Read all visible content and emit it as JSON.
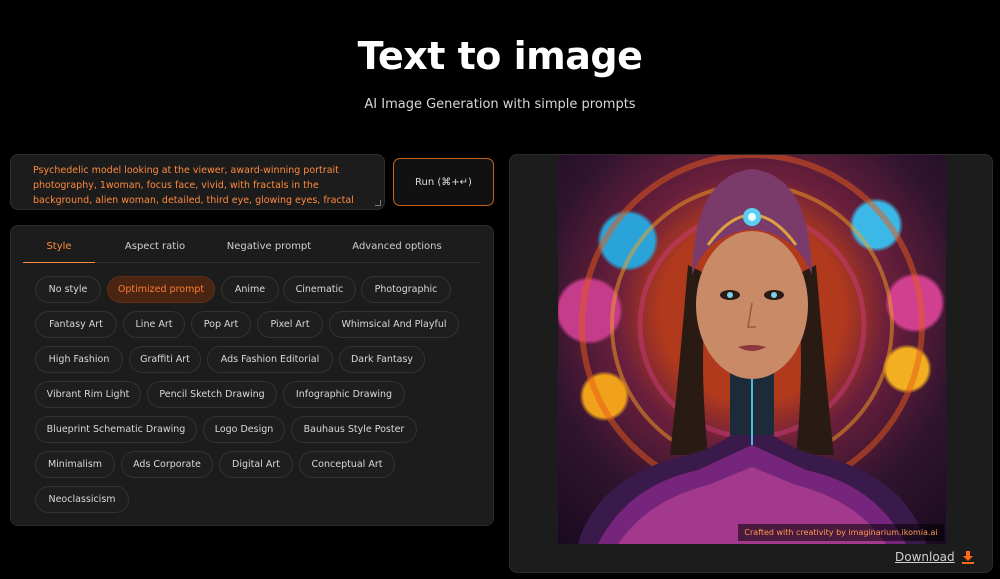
{
  "header": {
    "title": "Text to image",
    "subtitle": "AI Image Generation with simple prompts"
  },
  "prompt": {
    "value": "Psychedelic model looking at the viewer, award-winning portrait photography, 1woman, focus face, vivid, with fractals in the background, alien woman, detailed, third eye, glowing eyes, fractal"
  },
  "run_button": {
    "label": "Run (⌘+↵)"
  },
  "tabs": [
    {
      "label": "Style",
      "active": true
    },
    {
      "label": "Aspect ratio",
      "active": false
    },
    {
      "label": "Negative prompt",
      "active": false
    },
    {
      "label": "Advanced options",
      "active": false
    }
  ],
  "styles": [
    {
      "label": "No style",
      "selected": false
    },
    {
      "label": "Optimized prompt",
      "selected": true
    },
    {
      "label": "Anime",
      "selected": false
    },
    {
      "label": "Cinematic",
      "selected": false
    },
    {
      "label": "Photographic",
      "selected": false
    },
    {
      "label": "Fantasy Art",
      "selected": false
    },
    {
      "label": "Line Art",
      "selected": false
    },
    {
      "label": "Pop Art",
      "selected": false
    },
    {
      "label": "Pixel Art",
      "selected": false
    },
    {
      "label": "Whimsical And Playful",
      "selected": false
    },
    {
      "label": "High Fashion",
      "selected": false
    },
    {
      "label": "Graffiti Art",
      "selected": false
    },
    {
      "label": "Ads Fashion Editorial",
      "selected": false
    },
    {
      "label": "Dark Fantasy",
      "selected": false
    },
    {
      "label": "Vibrant Rim Light",
      "selected": false
    },
    {
      "label": "Pencil Sketch Drawing",
      "selected": false
    },
    {
      "label": "Infographic Drawing",
      "selected": false
    },
    {
      "label": "Blueprint Schematic Drawing",
      "selected": false
    },
    {
      "label": "Logo Design",
      "selected": false
    },
    {
      "label": "Bauhaus Style Poster",
      "selected": false
    },
    {
      "label": "Minimalism",
      "selected": false
    },
    {
      "label": "Ads Corporate",
      "selected": false
    },
    {
      "label": "Digital Art",
      "selected": false
    },
    {
      "label": "Conceptual Art",
      "selected": false
    },
    {
      "label": "Neoclassicism",
      "selected": false
    }
  ],
  "result": {
    "watermark": "Crafted with creativity by imaginarium.ikomia.ai",
    "download_label": "Download",
    "download_icon": "download-icon"
  },
  "colors": {
    "accent": "#ff8a3d",
    "background": "#000000",
    "panel": "#1c1c1c"
  }
}
